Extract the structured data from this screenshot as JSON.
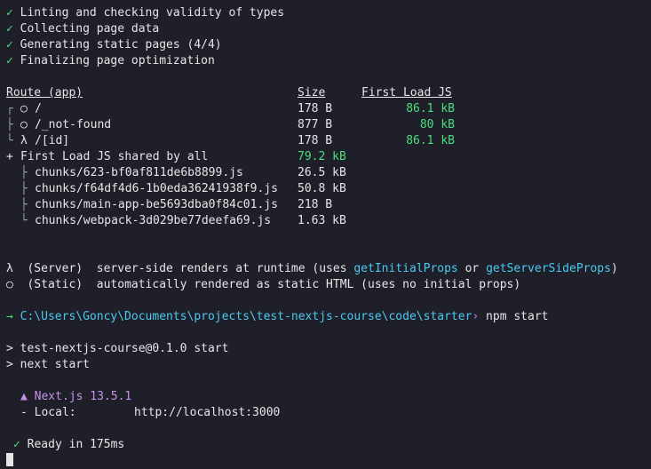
{
  "build_steps": [
    {
      "check": "✓",
      "text": "Linting and checking validity of types"
    },
    {
      "check": "✓",
      "text": "Collecting page data"
    },
    {
      "check": "✓",
      "text": "Generating static pages (4/4)"
    },
    {
      "check": "✓",
      "text": "Finalizing page optimization"
    }
  ],
  "route_table": {
    "headers": {
      "route": "Route (app)",
      "size": "Size",
      "first_load": "First Load JS"
    },
    "rows": [
      {
        "tree": "┌",
        "symbol": "○",
        "path": "/",
        "size": "178 B",
        "first_load": "86.1 kB"
      },
      {
        "tree": "├",
        "symbol": "○",
        "path": "/_not-found",
        "size": "877 B",
        "first_load": "80 kB"
      },
      {
        "tree": "└",
        "symbol": "λ",
        "path": "/[id]",
        "size": "178 B",
        "first_load": "86.1 kB"
      }
    ],
    "shared": {
      "prefix": "+",
      "label": "First Load JS shared by all",
      "size": "79.2 kB"
    },
    "chunks": [
      {
        "tree": "├",
        "name": "chunks/623-bf0af811de6b8899.js",
        "size": "26.5 kB"
      },
      {
        "tree": "├",
        "name": "chunks/f64df4d6-1b0eda36241938f9.js",
        "size": "50.8 kB"
      },
      {
        "tree": "├",
        "name": "chunks/main-app-be5693dba0f84c01.js",
        "size": "218 B"
      },
      {
        "tree": "└",
        "name": "chunks/webpack-3d029be77deefa69.js",
        "size": "1.63 kB"
      }
    ]
  },
  "legend": {
    "server": {
      "symbol": "λ",
      "kind": "(Server)",
      "pre": "server-side renders at runtime (uses ",
      "fn1": "getInitialProps",
      "mid": " or ",
      "fn2": "getServerSideProps",
      "post": ")"
    },
    "static": {
      "symbol": "○",
      "kind": "(Static)",
      "text": "automatically rendered as static HTML (uses no initial props)"
    }
  },
  "prompt": {
    "arrow": "→",
    "path": "C:\\Users\\Goncy\\Documents\\projects\\test-nextjs-course\\code\\starter",
    "caret": "›",
    "command": "npm start"
  },
  "npm_output": [
    "> test-nextjs-course@0.1.0 start",
    "> next start"
  ],
  "next_info": {
    "brand": "▲ Next.js 13.5.1",
    "local_label": "- Local:",
    "local_url": "http://localhost:3000"
  },
  "ready": {
    "check": "✓",
    "text": "Ready in 175ms"
  },
  "colors": {
    "background": "#1e1f29",
    "green": "#4ade80",
    "cyan": "#4cc9f0",
    "purple": "#c792ea"
  }
}
